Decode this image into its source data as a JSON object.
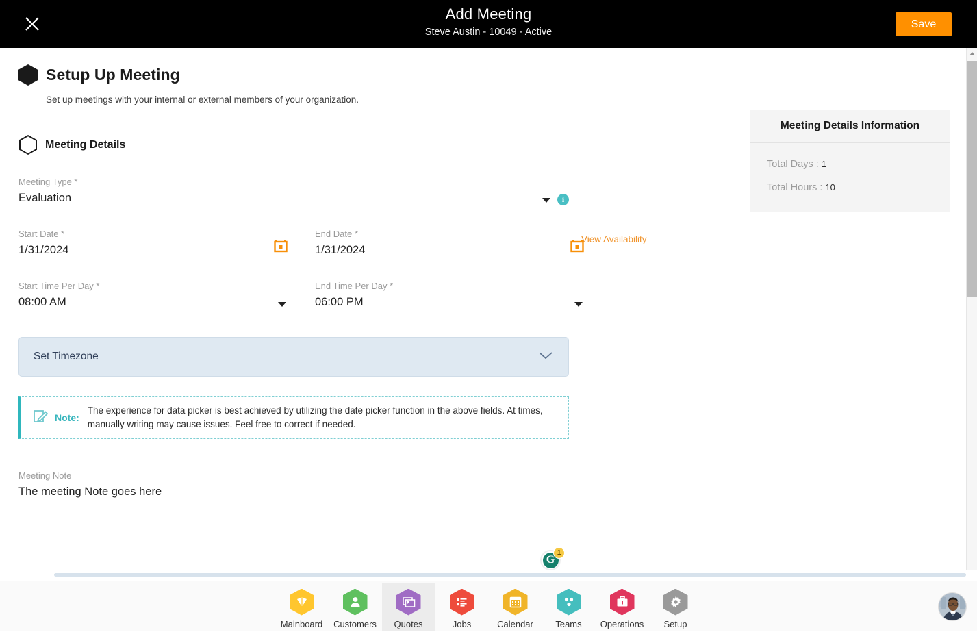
{
  "topbar": {
    "close_icon": "close-icon",
    "title": "Add Meeting",
    "subtitle": "Steve Austin - 10049 - Active",
    "save_label": "Save",
    "save_color": "#FF9000",
    "background": "#000000"
  },
  "section": {
    "title": "Setup Up Meeting",
    "description": "Set up meetings with your internal or external members of your organization.",
    "subsection_title": "Meeting Details"
  },
  "form": {
    "meeting_type": {
      "label": "Meeting Type *",
      "value": "Evaluation",
      "dropdown_icon": "chevron-down-icon",
      "info_icon": "info-icon",
      "info_glyph": "i"
    },
    "start_date": {
      "label": "Start Date *",
      "value": "1/31/2024",
      "calendar_icon": "calendar-icon"
    },
    "end_date": {
      "label": "End Date *",
      "value": "1/31/2024",
      "calendar_icon": "calendar-icon"
    },
    "view_availability": "View Availability",
    "start_time": {
      "label": "Start Time Per Day *",
      "value": "08:00 AM",
      "dropdown_icon": "chevron-down-icon"
    },
    "end_time": {
      "label": "End Time Per Day *",
      "value": "06:00 PM",
      "dropdown_icon": "chevron-down-icon"
    },
    "timezone": {
      "label": "Set Timezone",
      "chevron_icon": "chevron-down-icon",
      "background": "#dfe9f2"
    },
    "note": {
      "icon": "note-edit-icon",
      "word": "Note:",
      "text": "The experience for data picker is best achieved by utilizing the date picker function in the above fields. At times, manually writing may cause issues. Feel free to correct if needed.",
      "accent": "#2fb7bd"
    },
    "meeting_note": {
      "label": "Meeting Note",
      "value": "The meeting Note goes here"
    }
  },
  "grammarly": {
    "icon": "grammarly-icon",
    "glyph": "G",
    "badge_count": "1"
  },
  "info_panel": {
    "title": "Meeting Details Information",
    "rows": [
      {
        "label": "Total Days :",
        "value": "1"
      },
      {
        "label": "Total Hours :",
        "value": "10"
      }
    ]
  },
  "bottom_nav": {
    "items": [
      {
        "label": "Mainboard",
        "icon": "mainboard-icon",
        "color": "#FFC62E",
        "active": false
      },
      {
        "label": "Customers",
        "icon": "customers-icon",
        "color": "#5FC05F",
        "active": false
      },
      {
        "label": "Quotes",
        "icon": "quotes-icon",
        "color": "#A06CC4",
        "active": true
      },
      {
        "label": "Jobs",
        "icon": "jobs-icon",
        "color": "#EE4B3C",
        "active": false
      },
      {
        "label": "Calendar",
        "icon": "calendar-icon",
        "color": "#F0B429",
        "active": false
      },
      {
        "label": "Teams",
        "icon": "teams-icon",
        "color": "#45BEBE",
        "active": false
      },
      {
        "label": "Operations",
        "icon": "operations-icon",
        "color": "#E0365D",
        "active": false
      },
      {
        "label": "Setup",
        "icon": "setup-gear-icon",
        "color": "#9A9A9A",
        "active": false
      }
    ],
    "avatar": "user-avatar"
  },
  "scrollbars": {
    "vertical_up_icon": "scroll-up-arrow-icon"
  }
}
